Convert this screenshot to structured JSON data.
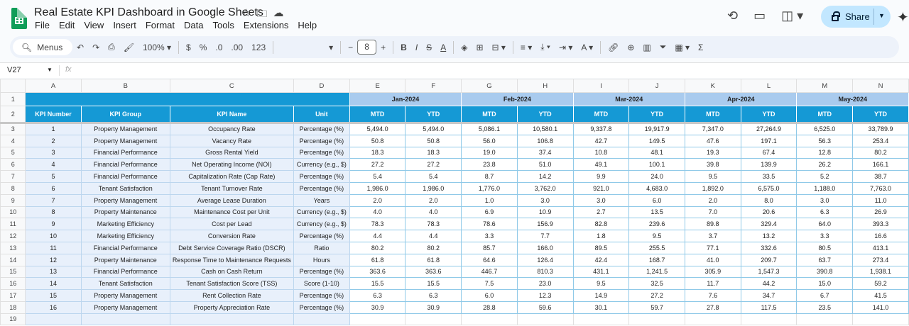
{
  "doc": {
    "title": "Real Estate KPI Dashboard in Google Sheets"
  },
  "menu": [
    "File",
    "Edit",
    "View",
    "Insert",
    "Format",
    "Data",
    "Tools",
    "Extensions",
    "Help"
  ],
  "share_label": "Share",
  "toolbar": {
    "menus": "Menus",
    "zoom": "100%",
    "currency": "$",
    "percent": "%",
    "dec_less": ".0",
    "dec_more": ".00",
    "numfmt": "123",
    "font_size": "8"
  },
  "formula_bar": {
    "name_box": "V27",
    "fx": "fx"
  },
  "columns": [
    "A",
    "B",
    "C",
    "D",
    "E",
    "F",
    "G",
    "H",
    "I",
    "J",
    "K",
    "L",
    "M",
    "N"
  ],
  "headers": [
    "KPI Number",
    "KPI Group",
    "KPI Name",
    "Unit"
  ],
  "months": [
    "Jan-2024",
    "Feb-2024",
    "Mar-2024",
    "Apr-2024",
    "May-2024"
  ],
  "sub_headers": {
    "mtd": "MTD",
    "ytd": "YTD"
  },
  "rows": [
    {
      "n": "1",
      "group": "Property Management",
      "name": "Occupancy Rate",
      "unit": "Percentage (%)",
      "vals": [
        "5,494.0",
        "5,494.0",
        "5,086.1",
        "10,580.1",
        "9,337.8",
        "19,917.9",
        "7,347.0",
        "27,264.9",
        "6,525.0",
        "33,789.9"
      ]
    },
    {
      "n": "2",
      "group": "Property Management",
      "name": "Vacancy Rate",
      "unit": "Percentage (%)",
      "vals": [
        "50.8",
        "50.8",
        "56.0",
        "106.8",
        "42.7",
        "149.5",
        "47.6",
        "197.1",
        "56.3",
        "253.4"
      ]
    },
    {
      "n": "3",
      "group": "Financial Performance",
      "name": "Gross Rental Yield",
      "unit": "Percentage (%)",
      "vals": [
        "18.3",
        "18.3",
        "19.0",
        "37.4",
        "10.8",
        "48.1",
        "19.3",
        "67.4",
        "12.8",
        "80.2"
      ]
    },
    {
      "n": "4",
      "group": "Financial Performance",
      "name": "Net Operating Income (NOI)",
      "unit": "Currency (e.g., $)",
      "vals": [
        "27.2",
        "27.2",
        "23.8",
        "51.0",
        "49.1",
        "100.1",
        "39.8",
        "139.9",
        "26.2",
        "166.1"
      ]
    },
    {
      "n": "5",
      "group": "Financial Performance",
      "name": "Capitalization Rate (Cap Rate)",
      "unit": "Percentage (%)",
      "vals": [
        "5.4",
        "5.4",
        "8.7",
        "14.2",
        "9.9",
        "24.0",
        "9.5",
        "33.5",
        "5.2",
        "38.7"
      ]
    },
    {
      "n": "6",
      "group": "Tenant Satisfaction",
      "name": "Tenant Turnover Rate",
      "unit": "Percentage (%)",
      "vals": [
        "1,986.0",
        "1,986.0",
        "1,776.0",
        "3,762.0",
        "921.0",
        "4,683.0",
        "1,892.0",
        "6,575.0",
        "1,188.0",
        "7,763.0"
      ]
    },
    {
      "n": "7",
      "group": "Property Management",
      "name": "Average Lease Duration",
      "unit": "Years",
      "vals": [
        "2.0",
        "2.0",
        "1.0",
        "3.0",
        "3.0",
        "6.0",
        "2.0",
        "8.0",
        "3.0",
        "11.0"
      ]
    },
    {
      "n": "8",
      "group": "Property Maintenance",
      "name": "Maintenance Cost per Unit",
      "unit": "Currency (e.g., $)",
      "vals": [
        "4.0",
        "4.0",
        "6.9",
        "10.9",
        "2.7",
        "13.5",
        "7.0",
        "20.6",
        "6.3",
        "26.9"
      ]
    },
    {
      "n": "9",
      "group": "Marketing Efficiency",
      "name": "Cost per Lead",
      "unit": "Currency (e.g., $)",
      "vals": [
        "78.3",
        "78.3",
        "78.6",
        "156.9",
        "82.8",
        "239.6",
        "89.8",
        "329.4",
        "64.0",
        "393.3"
      ]
    },
    {
      "n": "10",
      "group": "Marketing Efficiency",
      "name": "Conversion Rate",
      "unit": "Percentage (%)",
      "vals": [
        "4.4",
        "4.4",
        "3.3",
        "7.7",
        "1.8",
        "9.5",
        "3.7",
        "13.2",
        "3.3",
        "16.6"
      ]
    },
    {
      "n": "11",
      "group": "Financial Performance",
      "name": "Debt Service Coverage Ratio (DSCR)",
      "unit": "Ratio",
      "vals": [
        "80.2",
        "80.2",
        "85.7",
        "166.0",
        "89.5",
        "255.5",
        "77.1",
        "332.6",
        "80.5",
        "413.1"
      ]
    },
    {
      "n": "12",
      "group": "Property Maintenance",
      "name": "Response Time to Maintenance Requests",
      "unit": "Hours",
      "vals": [
        "61.8",
        "61.8",
        "64.6",
        "126.4",
        "42.4",
        "168.7",
        "41.0",
        "209.7",
        "63.7",
        "273.4"
      ]
    },
    {
      "n": "13",
      "group": "Financial Performance",
      "name": "Cash on Cash Return",
      "unit": "Percentage (%)",
      "vals": [
        "363.6",
        "363.6",
        "446.7",
        "810.3",
        "431.1",
        "1,241.5",
        "305.9",
        "1,547.3",
        "390.8",
        "1,938.1"
      ]
    },
    {
      "n": "14",
      "group": "Tenant Satisfaction",
      "name": "Tenant Satisfaction Score (TSS)",
      "unit": "Score (1-10)",
      "vals": [
        "15.5",
        "15.5",
        "7.5",
        "23.0",
        "9.5",
        "32.5",
        "11.7",
        "44.2",
        "15.0",
        "59.2"
      ]
    },
    {
      "n": "15",
      "group": "Property Management",
      "name": "Rent Collection Rate",
      "unit": "Percentage (%)",
      "vals": [
        "6.3",
        "6.3",
        "6.0",
        "12.3",
        "14.9",
        "27.2",
        "7.6",
        "34.7",
        "6.7",
        "41.5"
      ]
    },
    {
      "n": "16",
      "group": "Property Management",
      "name": "Property Appreciation Rate",
      "unit": "Percentage (%)",
      "vals": [
        "30.9",
        "30.9",
        "28.8",
        "59.6",
        "30.1",
        "59.7",
        "27.8",
        "117.5",
        "23.5",
        "141.0"
      ]
    }
  ],
  "colors": {
    "header_blue": "#1599d5",
    "month_blue": "#a9cbee",
    "left_fill": "#e8f0fb",
    "border_blue": "#8fc9e8"
  }
}
